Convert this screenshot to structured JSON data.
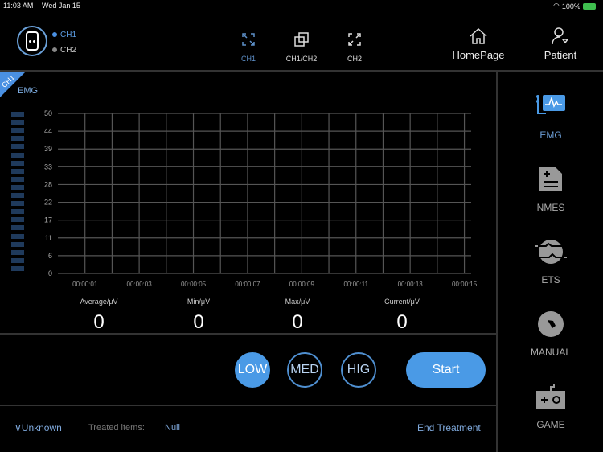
{
  "status_bar": {
    "time": "11:03 AM",
    "date": "Wed Jan 15",
    "battery": "100%"
  },
  "header": {
    "channels": [
      {
        "label": "CH1",
        "color": "#4a90e2"
      },
      {
        "label": "CH2",
        "color": "#888888"
      }
    ],
    "view_modes": [
      {
        "label": "CH1",
        "active": true
      },
      {
        "label": "CH1/CH2",
        "active": false
      },
      {
        "label": "CH2",
        "active": false
      }
    ],
    "homepage": "HomePage",
    "patient": "Patient"
  },
  "panel": {
    "badge": "CH1",
    "title": "EMG"
  },
  "chart_data": {
    "type": "line",
    "title": "EMG",
    "y_ticks": [
      "50",
      "44",
      "39",
      "33",
      "28",
      "22",
      "17",
      "11",
      "6",
      "0"
    ],
    "ylim": [
      0,
      50
    ],
    "x_ticks": [
      "00:00:01",
      "00:00:03",
      "00:00:05",
      "00:00:07",
      "00:00:09",
      "00:00:11",
      "00:00:13",
      "00:00:15"
    ],
    "series": [],
    "grid": true
  },
  "stats": [
    {
      "label": "Average/μV",
      "value": "0"
    },
    {
      "label": "Min/μV",
      "value": "0"
    },
    {
      "label": "Max/μV",
      "value": "0"
    },
    {
      "label": "Current/μV",
      "value": "0"
    }
  ],
  "levels": [
    {
      "label": "LOW",
      "active": true
    },
    {
      "label": "MED",
      "active": false
    },
    {
      "label": "HIG",
      "active": false
    }
  ],
  "start_label": "Start",
  "footer": {
    "user": "Unknown",
    "treated_label": "Treated items:",
    "treated_value": "Null",
    "end_label": "End Treatment"
  },
  "sidebar": [
    {
      "label": "EMG",
      "active": true
    },
    {
      "label": "NMES"
    },
    {
      "label": "ETS"
    },
    {
      "label": "MANUAL"
    },
    {
      "label": "GAME"
    }
  ],
  "colors": {
    "accent": "#4a9ae6",
    "bg": "#000000"
  }
}
